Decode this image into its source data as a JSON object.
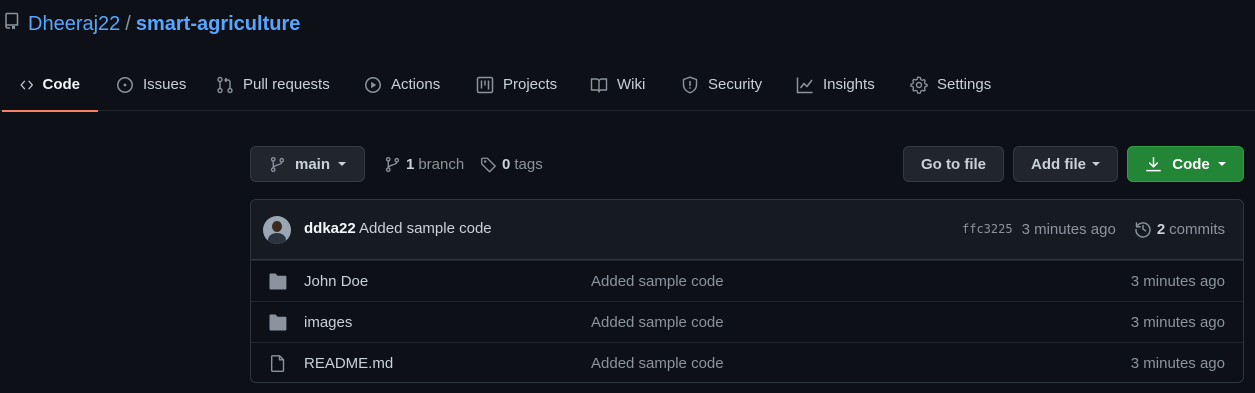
{
  "repo": {
    "owner": "Dheeraj22",
    "separator": "/",
    "name": "smart-agriculture"
  },
  "tabs": [
    {
      "label": "Code",
      "icon": "code-icon",
      "active": true
    },
    {
      "label": "Issues",
      "icon": "issue-icon"
    },
    {
      "label": "Pull requests",
      "icon": "pull-request-icon"
    },
    {
      "label": "Actions",
      "icon": "play-icon"
    },
    {
      "label": "Projects",
      "icon": "project-icon"
    },
    {
      "label": "Wiki",
      "icon": "book-icon"
    },
    {
      "label": "Security",
      "icon": "shield-icon"
    },
    {
      "label": "Insights",
      "icon": "graph-icon"
    },
    {
      "label": "Settings",
      "icon": "gear-icon"
    }
  ],
  "toolbar": {
    "branch": "main",
    "branch_count": "1",
    "branch_label": "branch",
    "tag_count": "0",
    "tag_label": "tags",
    "goto_file": "Go to file",
    "add_file": "Add file",
    "code": "Code"
  },
  "commit": {
    "author": "ddka22",
    "message": "Added sample code",
    "sha": "ffc3225",
    "time": "3 minutes ago",
    "count": "2",
    "count_label": "commits"
  },
  "files": [
    {
      "type": "folder",
      "name": "John Doe",
      "message": "Added sample code",
      "age": "3 minutes ago"
    },
    {
      "type": "folder",
      "name": "images",
      "message": "Added sample code",
      "age": "3 minutes ago"
    },
    {
      "type": "file",
      "name": "README.md",
      "message": "Added sample code",
      "age": "3 minutes ago"
    }
  ],
  "colors": {
    "background": "#0d1117",
    "link": "#58a6ff",
    "active_tab_underline": "#f78166",
    "primary_button": "#238636"
  }
}
